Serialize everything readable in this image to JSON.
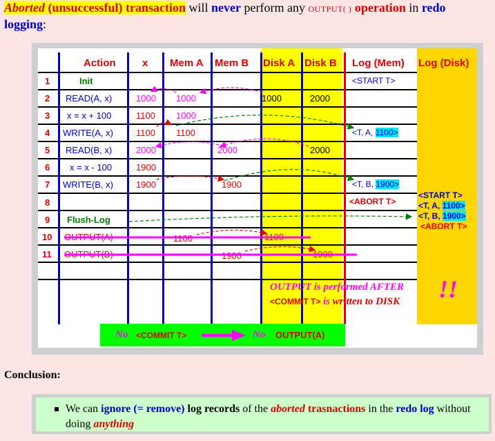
{
  "title": {
    "aborted": "Aborted",
    "unsuccessful": "(unsuccessful) transaction",
    "will": "will",
    "never": "never",
    "perform_any": "perform any",
    "output_op": "OUTPUT( )",
    "operation": "operation",
    "in": "in",
    "redo": "redo",
    "logging": "logging",
    "colon": ":"
  },
  "table": {
    "headers": [
      "Action",
      "x",
      "Mem A",
      "Mem B",
      "Disk A",
      "Disk B",
      "Log (Mem)",
      "Log (Disk)"
    ],
    "rows": [
      {
        "num": "1",
        "action": "Init"
      },
      {
        "num": "2",
        "action": "READ(A, x)"
      },
      {
        "num": "3",
        "action": "x = x + 100"
      },
      {
        "num": "4",
        "action": "WRITE(A, x)"
      },
      {
        "num": "5",
        "action": "READ(B, x)"
      },
      {
        "num": "6",
        "action": "x = x - 100"
      },
      {
        "num": "7",
        "action": "WRITE(B, x)"
      },
      {
        "num": "8",
        "action": ""
      },
      {
        "num": "9",
        "action": "Flush-Log"
      },
      {
        "num": "10",
        "action": "OUTPUT(A)"
      },
      {
        "num": "11",
        "action": "OUTPUT(B)"
      }
    ],
    "values": {
      "r2_x": "1000",
      "r2_memA": "1000",
      "r2_diskA": "1000",
      "r2_diskB": "2000",
      "r3_x": "1100",
      "r3_memA": "1000",
      "r4_x": "1100",
      "r4_memA": "1100",
      "r5_x": "2000",
      "r5_memB": "2000",
      "r5_diskB": "2000",
      "r6_x": "1900",
      "r7_x": "1900",
      "r7_memB": "1900",
      "r10_memA": "1100",
      "r10_diskA": "1100",
      "r11_memB": "1900",
      "r11_diskB": "1900"
    },
    "log_mem": {
      "r1": "<START T>",
      "r4_prefix": "<T, A,",
      "r4_val": "1100>",
      "r7_prefix": "<T, B,",
      "r7_val": "1900>",
      "r8": "<ABORT T>"
    },
    "log_disk": {
      "l1": "<START T>",
      "l2_prefix": "<T, A,",
      "l2_val": "1100>",
      "l3_prefix": "<T, B,",
      "l3_val": "1900>",
      "l4": "<ABORT T>"
    },
    "note": {
      "line1a": "OUTPUT",
      "line1b": "is performed",
      "line1c": "AFTER",
      "line2a": "<COMMIT T>",
      "line2b": "is",
      "line2c": "written to DISK",
      "bang": "!!"
    },
    "footer": {
      "no1": "No",
      "commit": "<COMMIT T>",
      "no2": "No",
      "output": "OUTPUT(A)"
    }
  },
  "conclusion": {
    "heading": "Conclusion:",
    "bullet": {
      "t1": "We can",
      "t2": "ignore (= remove)",
      "t3": "log records",
      "t4": "of the",
      "t5": "aborted",
      "t6": "trasnactions",
      "t7": "in the",
      "t8": "redo log",
      "t9": "without doing",
      "t10": "anything"
    }
  },
  "colors": {
    "background": "#fbe5e5",
    "disk_highlight": "#ffff00",
    "log_disk_column": "#ffd700",
    "header_red": "#e00000",
    "action_blue": "#0000cc",
    "green_box": "#00ff00",
    "conclusion_box": "#ccffcc"
  }
}
